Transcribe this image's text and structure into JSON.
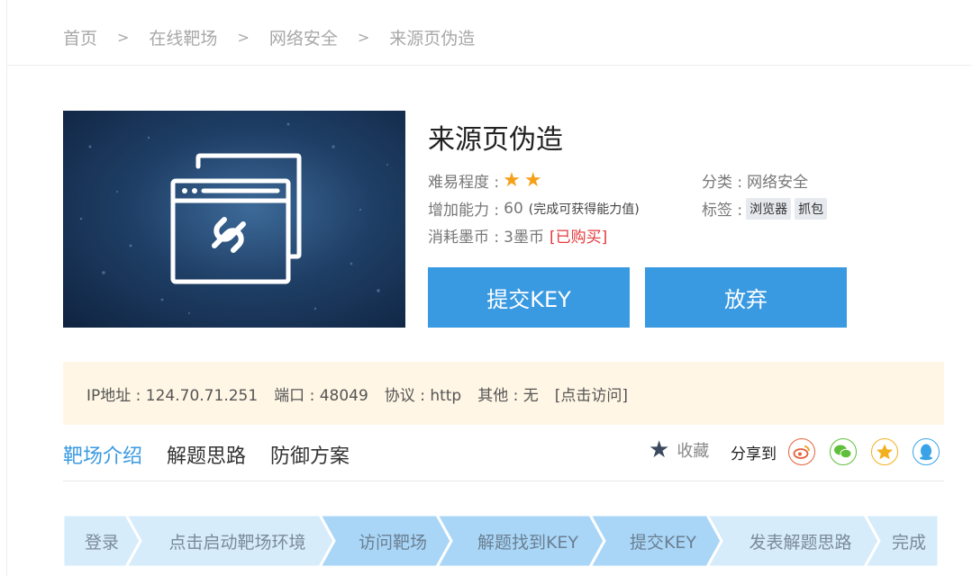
{
  "breadcrumb": {
    "items": [
      "首页",
      "在线靶场",
      "网络安全",
      "来源页伪造"
    ],
    "separator": ">"
  },
  "challenge": {
    "title": "来源页伪造",
    "difficulty_label": "难易程度 :",
    "difficulty_stars": 2,
    "ability_label": "增加能力 :",
    "ability_value": "60",
    "ability_note": "(完成可获得能力值)",
    "cost_label": "消耗墨币 :",
    "cost_value": "3墨币",
    "purchased": "[已购买]",
    "category_label": "分类 :",
    "category_value": "网络安全",
    "tags_label": "标签 :",
    "tags": [
      "浏览器",
      "抓包"
    ]
  },
  "buttons": {
    "submit_key": "提交KEY",
    "give_up": "放弃"
  },
  "target_info": {
    "ip": "IP地址 : 124.70.71.251",
    "port": "端口 : 48049",
    "protocol": "协议 : http",
    "other": "其他 : 无",
    "visit_link": "[点击访问]"
  },
  "tabs": [
    {
      "label": "靶场介绍",
      "active": true
    },
    {
      "label": "解题思路",
      "active": false
    },
    {
      "label": "防御方案",
      "active": false
    }
  ],
  "actions": {
    "favorite": "收藏",
    "share_label": "分享到",
    "share_targets": [
      "weibo-icon",
      "wechat-icon",
      "qzone-icon",
      "qq-icon"
    ]
  },
  "steps": [
    {
      "label": "登录",
      "state": "light"
    },
    {
      "label": "点击启动靶场环境",
      "state": "light"
    },
    {
      "label": "访问靶场",
      "state": "dark"
    },
    {
      "label": "解题找到KEY",
      "state": "dark"
    },
    {
      "label": "提交KEY",
      "state": "dark"
    },
    {
      "label": "发表解题思路",
      "state": "light"
    },
    {
      "label": "完成",
      "state": "light"
    }
  ],
  "colors": {
    "accent": "#3a9ae1",
    "star": "#f5a01a",
    "purchased": "#e4393c",
    "info_bg": "#fff6e5",
    "step_light": "#d6ecfb",
    "step_dark": "#a9d6f7"
  }
}
